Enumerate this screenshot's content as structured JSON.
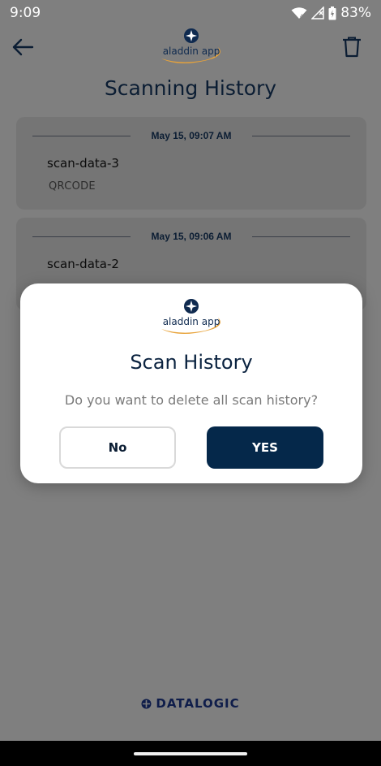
{
  "status_bar": {
    "time": "9:09",
    "battery": "83%"
  },
  "header": {
    "logo_text": "aladdin app"
  },
  "page_title": "Scanning History",
  "history": [
    {
      "date": "May 15, 09:07 AM",
      "name": "scan-data-3",
      "type": "QRCODE"
    },
    {
      "date": "May 15, 09:06 AM",
      "name": "scan-data-2",
      "type": ""
    }
  ],
  "dialog": {
    "logo_text": "aladdin app",
    "title": "Scan History",
    "message": "Do you want to delete all scan history?",
    "no_label": "No",
    "yes_label": "YES"
  },
  "footer": {
    "brand": "DATALOGIC"
  },
  "colors": {
    "primary": "#05284a",
    "overlay": "#7f7f7f",
    "accent_orange": "#e8a33a"
  }
}
